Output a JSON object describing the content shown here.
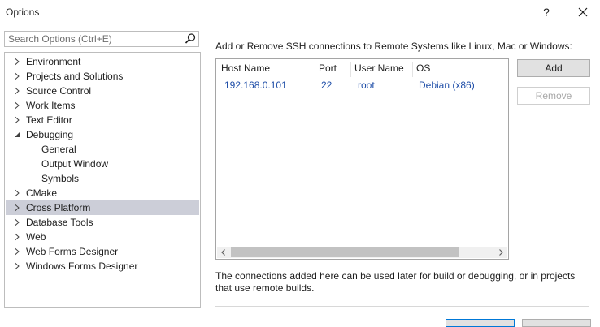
{
  "window": {
    "title": "Options",
    "help_glyph": "?",
    "close_glyph": "✕"
  },
  "search": {
    "placeholder": "Search Options (Ctrl+E)",
    "value": ""
  },
  "tree": {
    "items": [
      {
        "label": "Environment",
        "level": 0,
        "expander": "collapsed",
        "selected": false
      },
      {
        "label": "Projects and Solutions",
        "level": 0,
        "expander": "collapsed",
        "selected": false
      },
      {
        "label": "Source Control",
        "level": 0,
        "expander": "collapsed",
        "selected": false
      },
      {
        "label": "Work Items",
        "level": 0,
        "expander": "collapsed",
        "selected": false
      },
      {
        "label": "Text Editor",
        "level": 0,
        "expander": "collapsed",
        "selected": false
      },
      {
        "label": "Debugging",
        "level": 0,
        "expander": "expanded",
        "selected": false
      },
      {
        "label": "General",
        "level": 1,
        "expander": "none",
        "selected": false
      },
      {
        "label": "Output Window",
        "level": 1,
        "expander": "none",
        "selected": false
      },
      {
        "label": "Symbols",
        "level": 1,
        "expander": "none",
        "selected": false
      },
      {
        "label": "CMake",
        "level": 0,
        "expander": "collapsed",
        "selected": false
      },
      {
        "label": "Cross Platform",
        "level": 0,
        "expander": "collapsed",
        "selected": true
      },
      {
        "label": "Database Tools",
        "level": 0,
        "expander": "collapsed",
        "selected": false
      },
      {
        "label": "Web",
        "level": 0,
        "expander": "collapsed",
        "selected": false
      },
      {
        "label": "Web Forms Designer",
        "level": 0,
        "expander": "collapsed",
        "selected": false
      },
      {
        "label": "Windows Forms Designer",
        "level": 0,
        "expander": "collapsed",
        "selected": false
      }
    ]
  },
  "panel": {
    "description": "Add or Remove SSH connections to Remote Systems like Linux, Mac or Windows:",
    "columns": [
      "Host Name",
      "Port",
      "User Name",
      "OS"
    ],
    "rows": [
      {
        "host": "192.168.0.101",
        "port": "22",
        "user": "root",
        "os": "Debian (x86)"
      }
    ],
    "add_label": "Add",
    "remove_label": "Remove",
    "note": "The connections added here can be used later for build or debugging, or in projects that use remote builds."
  },
  "colors": {
    "selection": "#ccced8",
    "link_text": "#1f4ea8",
    "focus_border": "#0078d7"
  }
}
